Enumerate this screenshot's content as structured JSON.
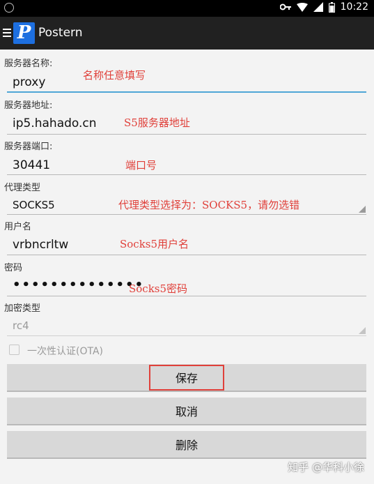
{
  "status_bar": {
    "time": "10:22"
  },
  "app_bar": {
    "logo_letter": "P",
    "title": "Postern"
  },
  "form": {
    "server_name": {
      "label": "服务器名称:",
      "value": "proxy",
      "annotation": "名称任意填写"
    },
    "server_address": {
      "label": "服务器地址:",
      "value": "ip5.hahado.cn",
      "annotation": "S5服务器地址"
    },
    "server_port": {
      "label": "服务器端口:",
      "value": "30441",
      "annotation": "端口号"
    },
    "proxy_type": {
      "label": "代理类型",
      "value": "SOCKS5",
      "annotation": "代理类型选择为：SOCKS5，请勿选错"
    },
    "username": {
      "label": "用户名",
      "value": "vrbncrltw",
      "annotation": "Socks5用户名"
    },
    "password": {
      "label": "密码",
      "value": "••••••••••••••",
      "annotation": "Socks5密码"
    },
    "encryption": {
      "label": "加密类型",
      "value": "rc4"
    },
    "ota": {
      "label": "一次性认证(OTA)",
      "checked": false
    }
  },
  "buttons": {
    "save": "保存",
    "cancel": "取消",
    "delete": "删除"
  },
  "watermark": "知乎 @华科小徐",
  "colors": {
    "annotation": "#e0403a",
    "focus_underline": "#4fa6d6",
    "logo_bg": "#1d6fe0"
  }
}
